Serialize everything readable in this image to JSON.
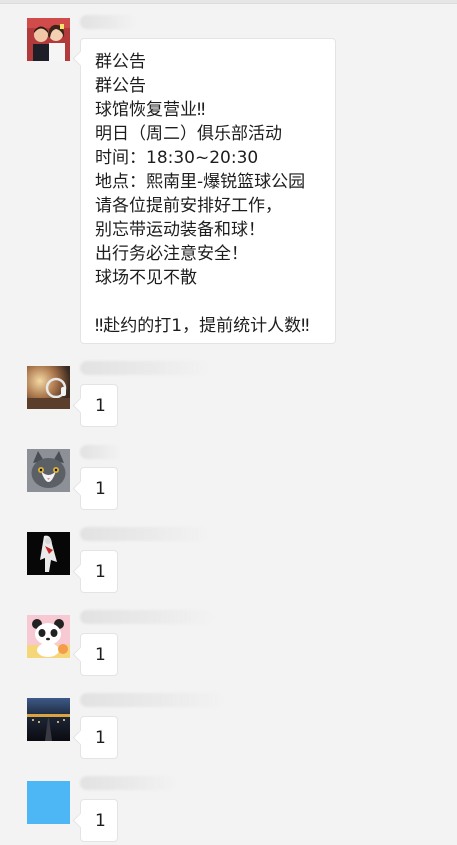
{
  "messages": [
    {
      "avatar_icon": "couple-photo-avatar-icon",
      "lines": [
        "群公告",
        "群公告",
        "球馆恢复营业‼",
        "明日（周二）俱乐部活动",
        "时间：18:30~20:30",
        "地点：熙南里-爆锐篮球公园",
        "请各位提前安排好工作，",
        "别忘带运动装备和球！",
        "出行务必注意安全！",
        "球场不见不散",
        "",
        "‼赴约的打1，提前统计人数‼"
      ]
    },
    {
      "avatar_icon": "headphones-photo-avatar-icon",
      "text": "1"
    },
    {
      "avatar_icon": "cat-photo-avatar-icon",
      "text": "1"
    },
    {
      "avatar_icon": "dark-figure-avatar-icon",
      "text": "1"
    },
    {
      "avatar_icon": "panda-cartoon-avatar-icon",
      "text": "1"
    },
    {
      "avatar_icon": "night-runway-avatar-icon",
      "text": "1"
    },
    {
      "avatar_icon": "blue-square-avatar-icon",
      "text": "1"
    }
  ],
  "colors": {
    "background": "#f3f3f3",
    "bubble": "#ffffff",
    "bubble_border": "#e4e4e4",
    "text": "#1d1d1d",
    "blue_avatar": "#4db6f5"
  }
}
